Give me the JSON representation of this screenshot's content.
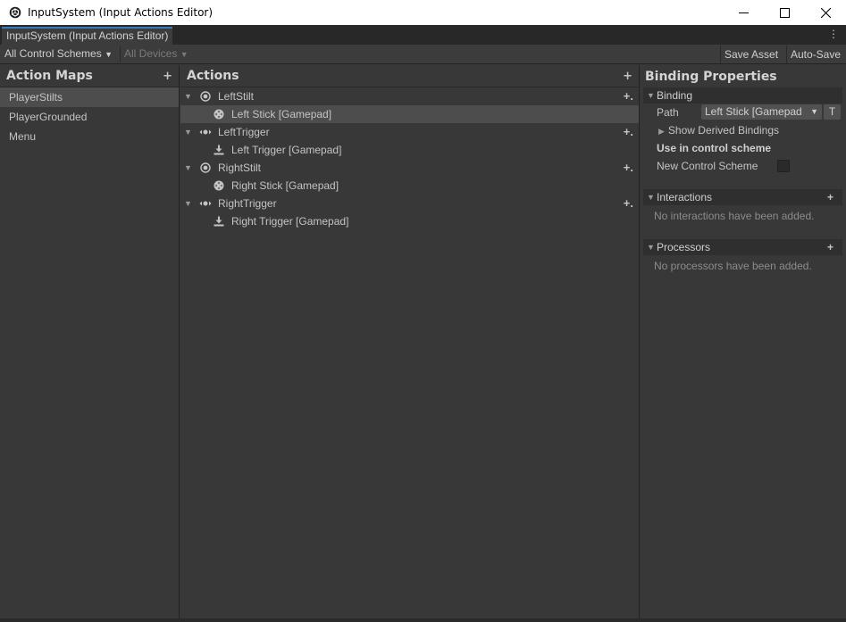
{
  "window": {
    "title": "InputSystem (Input Actions Editor)",
    "minimize_icon": "minimize-icon",
    "maximize_icon": "maximize-icon",
    "close_icon": "close-icon"
  },
  "tab": {
    "label": "InputSystem (Input Actions Editor)",
    "accent_color": "#3a79bb"
  },
  "toolbar": {
    "control_schemes": "All Control Schemes",
    "devices": "All Devices",
    "save_asset": "Save Asset",
    "auto_save": "Auto-Save"
  },
  "action_maps": {
    "title": "Action Maps",
    "items": [
      {
        "label": "PlayerStilts",
        "selected": true
      },
      {
        "label": "PlayerGrounded",
        "selected": false
      },
      {
        "label": "Menu",
        "selected": false
      }
    ]
  },
  "actions": {
    "title": "Actions",
    "rows": [
      {
        "label": "LeftStilt",
        "icon": "stick-action-icon"
      },
      {
        "label": "Left Stick [Gamepad]",
        "icon": "gamepad-stick-icon"
      },
      {
        "label": "LeftTrigger",
        "icon": "axis-action-icon"
      },
      {
        "label": "Left Trigger [Gamepad]",
        "icon": "trigger-icon"
      },
      {
        "label": "RightStilt",
        "icon": "stick-action-icon"
      },
      {
        "label": "Right Stick [Gamepad]",
        "icon": "gamepad-stick-icon"
      },
      {
        "label": "RightTrigger",
        "icon": "axis-action-icon"
      },
      {
        "label": "Right Trigger [Gamepad]",
        "icon": "trigger-icon"
      }
    ]
  },
  "binding_properties": {
    "title": "Binding Properties",
    "binding_header": "Binding",
    "path_label": "Path",
    "path_value": "Left Stick [Gamepad",
    "t_button": "T",
    "show_derived": "Show Derived Bindings",
    "use_in_scheme": "Use in control scheme",
    "new_scheme": "New Control Scheme",
    "interactions_header": "Interactions",
    "interactions_empty": "No interactions have been added.",
    "processors_header": "Processors",
    "processors_empty": "No processors have been added."
  }
}
